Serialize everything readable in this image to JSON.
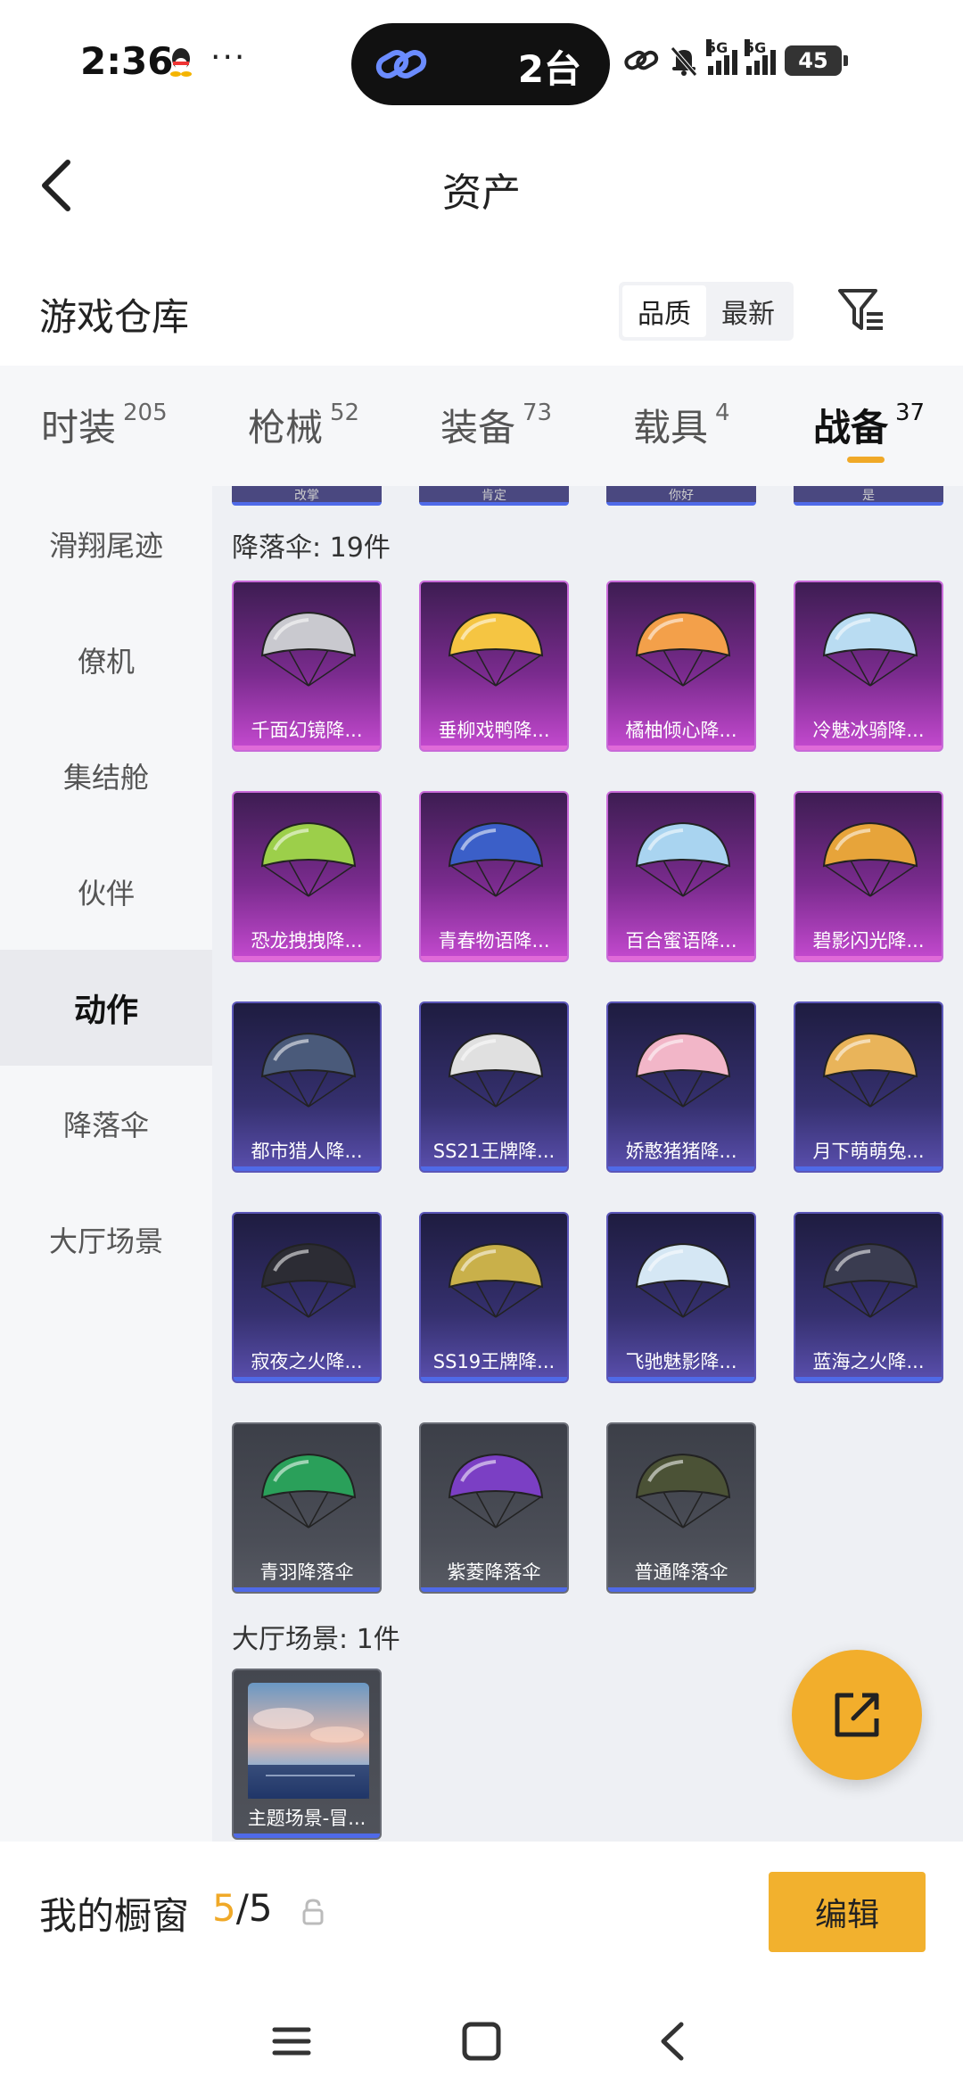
{
  "status_bar": {
    "time": "2:36",
    "more_dots": "···",
    "island_text": "2台",
    "signal_label_1": "5G",
    "signal_label_2": "5G",
    "battery": "45"
  },
  "header": {
    "title": "资产"
  },
  "warehouse": {
    "title": "游戏仓库",
    "sort_options": [
      "品质",
      "最新"
    ],
    "active_sort": "品质"
  },
  "category_tabs": [
    {
      "label": "时装",
      "count": "205"
    },
    {
      "label": "枪械",
      "count": "52"
    },
    {
      "label": "装备",
      "count": "73"
    },
    {
      "label": "载具",
      "count": "4"
    },
    {
      "label": "战备",
      "count": "37",
      "active": true
    }
  ],
  "sidebar": {
    "items": [
      "滑翔尾迹",
      "僚机",
      "集结舱",
      "伙伴",
      "动作",
      "降落伞",
      "大厅场景"
    ],
    "active": "动作"
  },
  "content": {
    "partial_row_labels": [
      "改掌",
      "肯定",
      "你好",
      "是"
    ],
    "parachute_section": "降落伞: 19件",
    "parachutes": [
      {
        "name": "千面幻镜降...",
        "tier": "purple"
      },
      {
        "name": "垂柳戏鸭降...",
        "tier": "purple"
      },
      {
        "name": "橘柚倾心降...",
        "tier": "purple"
      },
      {
        "name": "冷魅冰骑降...",
        "tier": "purple"
      },
      {
        "name": "恐龙拽拽降...",
        "tier": "purple"
      },
      {
        "name": "青春物语降...",
        "tier": "purple"
      },
      {
        "name": "百合蜜语降...",
        "tier": "purple"
      },
      {
        "name": "碧影闪光降...",
        "tier": "purple"
      },
      {
        "name": "都市猎人降...",
        "tier": "blue"
      },
      {
        "name": "SS21王牌降...",
        "tier": "blue"
      },
      {
        "name": "娇憨猪猪降...",
        "tier": "blue"
      },
      {
        "name": "月下萌萌兔...",
        "tier": "blue"
      },
      {
        "name": "寂夜之火降...",
        "tier": "blue"
      },
      {
        "name": "SS19王牌降...",
        "tier": "blue"
      },
      {
        "name": "飞驰魅影降...",
        "tier": "blue"
      },
      {
        "name": "蓝海之火降...",
        "tier": "blue"
      },
      {
        "name": "青羽降落伞",
        "tier": "gray"
      },
      {
        "name": "紫菱降落伞",
        "tier": "gray"
      },
      {
        "name": "普通降落伞",
        "tier": "gray"
      }
    ],
    "scene_section": "大厅场景: 1件",
    "scenes": [
      {
        "name": "主题场景-冒..."
      }
    ]
  },
  "showcase": {
    "label": "我的橱窗",
    "current": "5",
    "separator": "/",
    "total": "5",
    "edit_label": "编辑"
  },
  "colors": {
    "accent": "#f2b12e",
    "purple_tier": "#c54ad0",
    "blue_tier": "#5a4fae",
    "gray_tier": "#575a63",
    "rarity_bar": "#4f6ae8"
  }
}
